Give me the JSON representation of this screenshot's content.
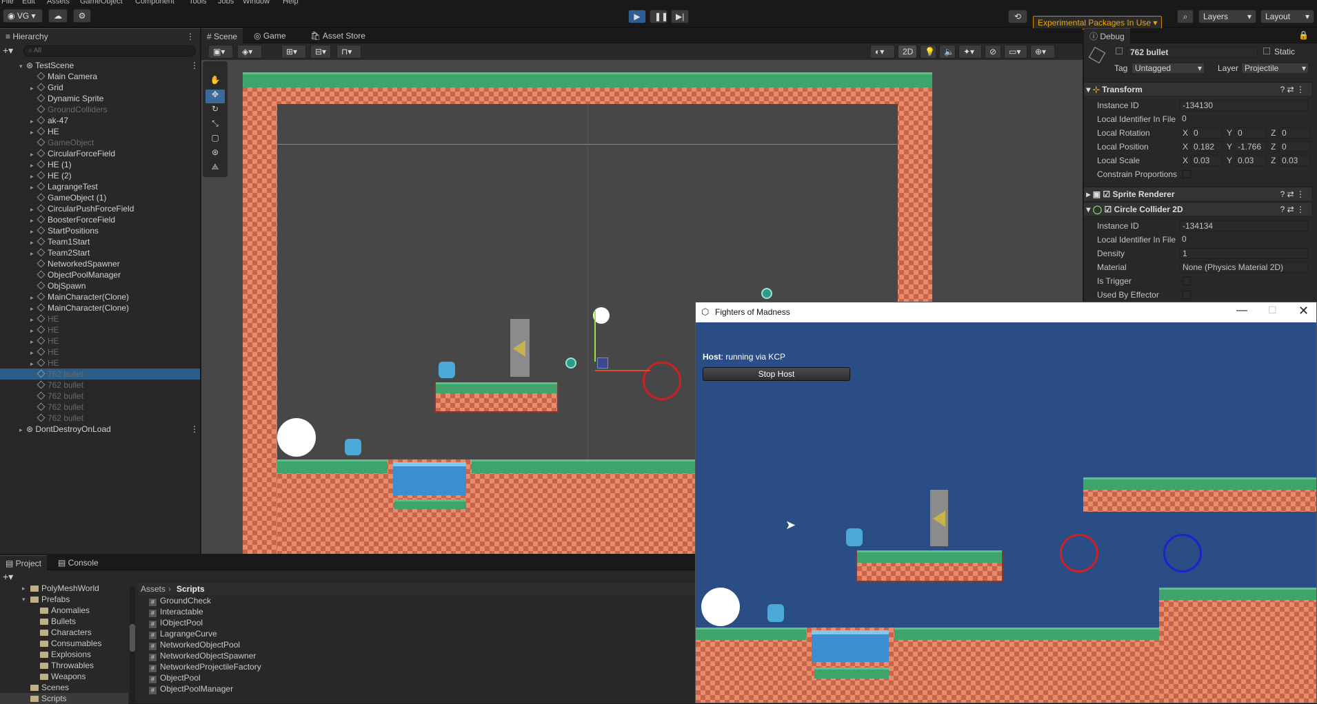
{
  "menu": [
    "File",
    "Edit",
    "Assets",
    "GameObject",
    "Component",
    "Tools",
    "Jobs",
    "Window",
    "Help"
  ],
  "toolbar": {
    "account": "VG",
    "experimental": "Experimental Packages In Use",
    "layers": "Layers",
    "layout": "Layout"
  },
  "hierarchy": {
    "tab": "Hierarchy",
    "search_placeholder": "All",
    "items": [
      {
        "label": "TestScene",
        "level": 0,
        "kind": "scene",
        "dim": false,
        "sel": false
      },
      {
        "label": "Main Camera",
        "level": 1,
        "dim": false
      },
      {
        "label": "Grid",
        "level": 1,
        "dim": false,
        "arrow": true
      },
      {
        "label": "Dynamic Sprite",
        "level": 1,
        "dim": false
      },
      {
        "label": "GroundColliders",
        "level": 1,
        "dim": true
      },
      {
        "label": "ak-47",
        "level": 1,
        "dim": false,
        "arrow": true
      },
      {
        "label": "HE",
        "level": 1,
        "dim": false,
        "arrow": true
      },
      {
        "label": "GameObject",
        "level": 1,
        "dim": true
      },
      {
        "label": "CircularForceField",
        "level": 1,
        "dim": false,
        "arrow": true
      },
      {
        "label": "HE (1)",
        "level": 1,
        "dim": false,
        "arrow": true
      },
      {
        "label": "HE (2)",
        "level": 1,
        "dim": false,
        "arrow": true
      },
      {
        "label": "LagrangeTest",
        "level": 1,
        "dim": false,
        "arrow": true
      },
      {
        "label": "GameObject (1)",
        "level": 1,
        "dim": false
      },
      {
        "label": "CircularPushForceField",
        "level": 1,
        "dim": false,
        "arrow": true
      },
      {
        "label": "BoosterForceField",
        "level": 1,
        "dim": false,
        "arrow": true
      },
      {
        "label": "StartPositions",
        "level": 1,
        "dim": false,
        "arrow": true
      },
      {
        "label": "Team1Start",
        "level": 1,
        "dim": false,
        "arrow": true
      },
      {
        "label": "Team2Start",
        "level": 1,
        "dim": false,
        "arrow": true
      },
      {
        "label": "NetworkedSpawner",
        "level": 1,
        "dim": false
      },
      {
        "label": "ObjectPoolManager",
        "level": 1,
        "dim": false
      },
      {
        "label": "ObjSpawn",
        "level": 1,
        "dim": false
      },
      {
        "label": "MainCharacter(Clone)",
        "level": 1,
        "dim": false,
        "arrow": true
      },
      {
        "label": "MainCharacter(Clone)",
        "level": 1,
        "dim": false,
        "arrow": true
      },
      {
        "label": "HE",
        "level": 1,
        "dim": true,
        "arrow": true
      },
      {
        "label": "HE",
        "level": 1,
        "dim": true,
        "arrow": true
      },
      {
        "label": "HE",
        "level": 1,
        "dim": true,
        "arrow": true
      },
      {
        "label": "HE",
        "level": 1,
        "dim": true,
        "arrow": true
      },
      {
        "label": "HE",
        "level": 1,
        "dim": true,
        "arrow": true
      },
      {
        "label": "762 bullet",
        "level": 1,
        "dim": true,
        "sel": true
      },
      {
        "label": "762 bullet",
        "level": 1,
        "dim": true
      },
      {
        "label": "762 bullet",
        "level": 1,
        "dim": true
      },
      {
        "label": "762 bullet",
        "level": 1,
        "dim": true
      },
      {
        "label": "762 bullet",
        "level": 1,
        "dim": true
      },
      {
        "label": "DontDestroyOnLoad",
        "level": 0,
        "kind": "scene",
        "dim": false
      }
    ]
  },
  "scene_tabs": {
    "scene": "Scene",
    "game": "Game",
    "asset_store": "Asset Store",
    "mode_2d": "2D"
  },
  "inspector": {
    "tab": "Debug",
    "object_name": "762 bullet",
    "static_label": "Static",
    "tag_label": "Tag",
    "tag_value": "Untagged",
    "layer_label": "Layer",
    "layer_value": "Projectile",
    "transform": {
      "title": "Transform",
      "instance_id_label": "Instance ID",
      "instance_id": "-134130",
      "local_id_label": "Local Identifier In File",
      "local_id": "0",
      "rotation_label": "Local Rotation",
      "rot": [
        "0",
        "0",
        "0"
      ],
      "position_label": "Local Position",
      "pos": [
        "0.182",
        "-1.766",
        "0"
      ],
      "scale_label": "Local Scale",
      "scale": [
        "0.03",
        "0.03",
        "0.03"
      ],
      "constrain_label": "Constrain Proportions"
    },
    "sprite_renderer": "Sprite Renderer",
    "circle_collider": {
      "title": "Circle Collider 2D",
      "instance_id_label": "Instance ID",
      "instance_id": "-134134",
      "local_id_label": "Local Identifier In File",
      "local_id": "0",
      "density_label": "Density",
      "density": "1",
      "material_label": "Material",
      "material": "None (Physics Material 2D)",
      "trigger_label": "Is Trigger",
      "effector_label": "Used By Effector"
    },
    "axes": [
      "X",
      "Y",
      "Z"
    ]
  },
  "game_window": {
    "title": "Fighters of Madness",
    "host_label": "Host",
    "host_status": ": running via KCP",
    "stop_button": "Stop Host"
  },
  "project": {
    "tab_project": "Project",
    "tab_console": "Console",
    "tree": [
      {
        "label": "PolyMeshWorld",
        "x": 44,
        "arrow": true
      },
      {
        "label": "Prefabs",
        "x": 44,
        "arrow": true,
        "open": true
      },
      {
        "label": "Anomalies",
        "x": 58
      },
      {
        "label": "Bullets",
        "x": 58
      },
      {
        "label": "Characters",
        "x": 58
      },
      {
        "label": "Consumables",
        "x": 58
      },
      {
        "label": "Explosions",
        "x": 58
      },
      {
        "label": "Throwables",
        "x": 58
      },
      {
        "label": "Weapons",
        "x": 58
      },
      {
        "label": "Scenes",
        "x": 44
      },
      {
        "label": "Scripts",
        "x": 44,
        "sel": true
      }
    ],
    "breadcrumb": [
      "Assets",
      "Scripts"
    ],
    "files": [
      "GroundCheck",
      "Interactable",
      "IObjectPool",
      "LagrangeCurve",
      "NetworkedObjectPool",
      "NetworkedObjectSpawner",
      "NetworkedProjectileFactory",
      "ObjectPool",
      "ObjectPoolManager"
    ]
  }
}
